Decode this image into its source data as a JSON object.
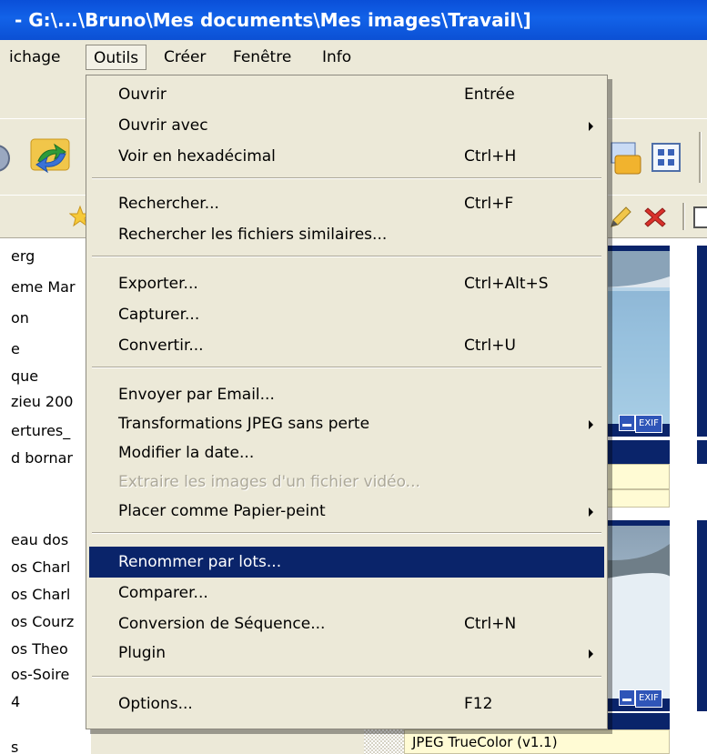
{
  "window": {
    "title": " - G:\\...\\Bruno\\Mes documents\\Mes images\\Travail\\]"
  },
  "menubar": {
    "items": [
      {
        "label": "ichage"
      },
      {
        "label": "Outils"
      },
      {
        "label": "Créer"
      },
      {
        "label": "Fenêtre"
      },
      {
        "label": "Info"
      }
    ]
  },
  "left_list": {
    "items": [
      "erg",
      "eme Mar",
      "on",
      "e",
      "que",
      "zieu 200",
      "ertures_",
      "d bornar",
      "",
      "eau dos",
      "os Charl",
      "os Charl",
      "os Courz",
      "os Theo",
      "os-Soire",
      "4",
      "",
      "s"
    ]
  },
  "thumbnails": {
    "info1": "(v1.1)",
    "info2": "JPEG TrueColor (v1.1)",
    "exif_label": "EXIF"
  },
  "colors": {
    "highlight": "#0a246a",
    "menu_bg": "#ece9d8",
    "titlebar": "#0a4fd8"
  },
  "menu": {
    "items": [
      {
        "type": "item",
        "label": "Ouvrir",
        "shortcut": "Entrée"
      },
      {
        "type": "item",
        "label": "Ouvrir avec",
        "shortcut": "",
        "submenu": true
      },
      {
        "type": "item",
        "label": "Voir en hexadécimal",
        "shortcut": "Ctrl+H"
      },
      {
        "type": "sep"
      },
      {
        "type": "item",
        "label": "Rechercher...",
        "shortcut": "Ctrl+F"
      },
      {
        "type": "item",
        "label": "Rechercher les fichiers similaires...",
        "shortcut": ""
      },
      {
        "type": "sep"
      },
      {
        "type": "item",
        "label": "Exporter...",
        "shortcut": "Ctrl+Alt+S"
      },
      {
        "type": "item",
        "label": "Capturer...",
        "shortcut": ""
      },
      {
        "type": "item",
        "label": "Convertir...",
        "shortcut": "Ctrl+U"
      },
      {
        "type": "sep"
      },
      {
        "type": "item",
        "label": "Envoyer par Email...",
        "shortcut": ""
      },
      {
        "type": "item",
        "label": "Transformations JPEG sans perte",
        "shortcut": "",
        "submenu": true
      },
      {
        "type": "item",
        "label": "Modifier la date...",
        "shortcut": ""
      },
      {
        "type": "item",
        "label": "Extraire les images d'un fichier vidéo...",
        "shortcut": "",
        "disabled": true
      },
      {
        "type": "item",
        "label": "Placer comme Papier-peint",
        "shortcut": "",
        "submenu": true
      },
      {
        "type": "sep"
      },
      {
        "type": "item",
        "label": "Renommer par lots...",
        "shortcut": "",
        "highlighted": true
      },
      {
        "type": "item",
        "label": "Comparer...",
        "shortcut": ""
      },
      {
        "type": "item",
        "label": "Conversion de Séquence...",
        "shortcut": "Ctrl+N"
      },
      {
        "type": "item",
        "label": "Plugin",
        "shortcut": "",
        "submenu": true
      },
      {
        "type": "sep"
      },
      {
        "type": "item",
        "label": "Options...",
        "shortcut": "F12"
      }
    ]
  }
}
